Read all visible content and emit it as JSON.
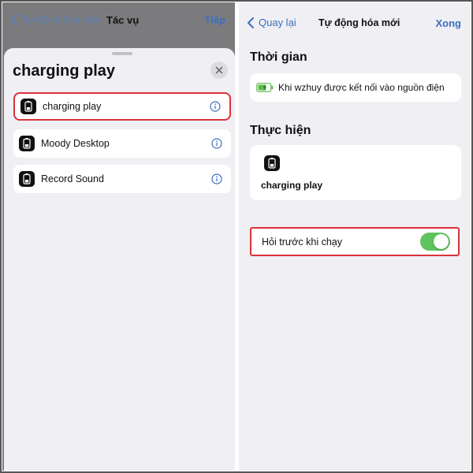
{
  "left": {
    "back_label": "Tự động hóa mới",
    "title": "Tác vụ",
    "next_label": "Tiếp",
    "sheet_title": "charging play",
    "shortcuts": [
      {
        "label": "charging play",
        "highlighted": true
      },
      {
        "label": "Moody Desktop",
        "highlighted": false
      },
      {
        "label": "Record Sound",
        "highlighted": false
      }
    ]
  },
  "right": {
    "back_label": "Quay lại",
    "title": "Tự động hóa mới",
    "done_label": "Xong",
    "when_title": "Thời gian",
    "trigger_text": "Khi wzhuy được kết nối vào nguồn điện",
    "do_title": "Thực hiện",
    "action_label": "charging play",
    "ask_label": "Hỏi trước khi chạy",
    "ask_enabled": true
  },
  "colors": {
    "accent": "#3d6fbf",
    "highlight_border": "#d9333a",
    "toggle_on": "#5fc35f"
  },
  "icons": {
    "shortcut": "phone-battery-icon",
    "info": "info-circle-icon",
    "close": "close-icon",
    "back": "chevron-left-icon",
    "trigger": "battery-charging-icon"
  }
}
